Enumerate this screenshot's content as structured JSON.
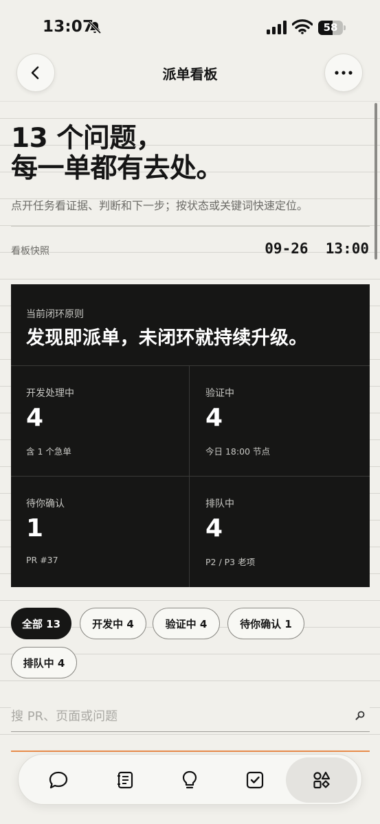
{
  "status": {
    "time": "13:07",
    "battery": "58",
    "battery_level": 0.58
  },
  "nav": {
    "title": "派单看板",
    "back_icon": "chevron-left-icon",
    "more_icon": "ellipsis-icon"
  },
  "hero": {
    "title_line1": "13 个问题，",
    "title_line2": "每一单都有去处。",
    "subtitle": "点开任务看证据、判断和下一步；按状态或关键词快速定位。"
  },
  "snapshot": {
    "label": "看板快照",
    "time": "09-26  13:00"
  },
  "card": {
    "kicker": "当前闭环原则",
    "headline": "发现即派单，未闭环就持续升级。",
    "stats": [
      {
        "label": "开发处理中",
        "value": "4",
        "note": "含 1 个急单"
      },
      {
        "label": "验证中",
        "value": "4",
        "note": "今日 18:00 节点"
      },
      {
        "label": "待你确认",
        "value": "1",
        "note": "PR #37"
      },
      {
        "label": "排队中",
        "value": "4",
        "note": "P2 / P3 老项"
      }
    ]
  },
  "filters": [
    {
      "label": "全部 13",
      "active": true
    },
    {
      "label": "开发中 4",
      "active": false
    },
    {
      "label": "验证中 4",
      "active": false
    },
    {
      "label": "待你确认 1",
      "active": false
    },
    {
      "label": "排队中 4",
      "active": false
    }
  ],
  "search": {
    "placeholder": "搜 PR、页面或问题",
    "value": ""
  },
  "tabbar": {
    "tabs": [
      {
        "icon": "chat-bubble-icon",
        "active": false
      },
      {
        "icon": "document-list-icon",
        "active": false
      },
      {
        "icon": "lightbulb-icon",
        "active": false
      },
      {
        "icon": "checkbox-icon",
        "active": false
      },
      {
        "icon": "shapes-icon",
        "active": true
      }
    ]
  },
  "colors": {
    "background": "#f1f0eb",
    "card": "#161615",
    "accent": "#e88b4a",
    "text": "#151515",
    "muted": "#6c6b67"
  }
}
